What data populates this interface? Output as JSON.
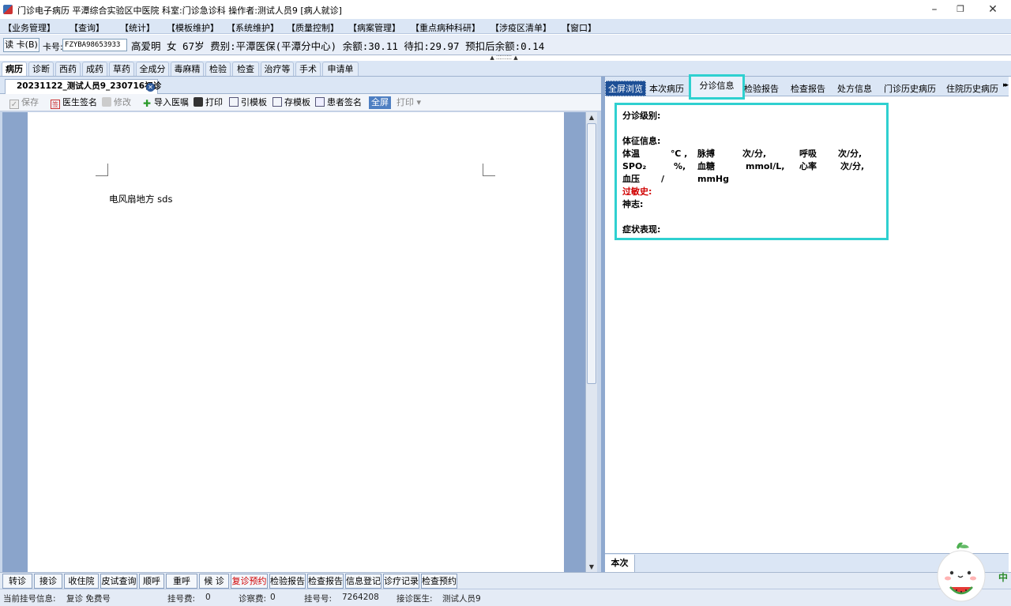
{
  "titlebar": {
    "title": "门诊电子病历  平潭综合实验区中医院  科室:门诊急诊科  操作者:测试人员9  [病人就诊]",
    "minimize": "–",
    "restore": "❐",
    "close": "✕"
  },
  "menu": [
    "【业务管理】",
    "【查询】",
    "【统计】",
    "【模板维护】",
    "【系统维护】",
    "【质量控制】",
    "【病案管理】",
    "【重点病种科研】",
    "【涉疫区清单】",
    "【窗口】"
  ],
  "patient": {
    "read_card": "读 卡(B)",
    "card_label": "卡号:",
    "card_no": "FZYBA98653933",
    "info": "高爱明 女 67岁 费别:平潭医保(平潭分中心) 余额:30.11 待扣:29.97 预扣后余额:0.14"
  },
  "splitter_grip": "▲ ⁚⁚⁚⁚⁚⁚⁚⁚⁚ ▲",
  "main_tabs": [
    "病历",
    "诊断",
    "西药",
    "成药",
    "草药",
    "全成分",
    "毒麻精",
    "检验",
    "检查",
    "治疗等",
    "手术",
    "申请单"
  ],
  "doc": {
    "tab_title": "20231122_测试人员9_230716初诊",
    "tab_close": "✕",
    "content": "电风扇地方 sds"
  },
  "doc_toolbar": {
    "save": "保存",
    "doctor_sign": "医生签名",
    "modify": "修改",
    "import_order": "导入医嘱",
    "print": "打印",
    "cite_template": "引模板",
    "save_template": "存模板",
    "patient_sign": "患者签名",
    "fullscreen": "全屏",
    "print2": "打印",
    "print2_arrow": "▾"
  },
  "scroll": {
    "up": "▲",
    "down": "▼"
  },
  "right_tabs": {
    "full_preview": "全屏浏览",
    "tabs": [
      "本次病历",
      "分诊信息",
      "检验报告",
      "检查报告",
      "处方信息",
      "门诊历史病历",
      "住院历史病历"
    ],
    "more": "▸▸"
  },
  "triage": {
    "level_label": "分诊级别:",
    "vitals_label": "体征信息:",
    "temp": "体温",
    "temp_unit": "℃ ,",
    "pulse": "脉搏",
    "pulse_unit": "次/分,",
    "resp": "呼吸",
    "resp_unit": "次/分,",
    "spo2": "SPO₂",
    "spo2_unit": "%,",
    "glucose": "血糖",
    "glucose_unit": "mmol/L,",
    "heart_rate": "心率",
    "hr_unit": "次/分,",
    "bp": "血压",
    "bp_sep": "/",
    "bp_unit": "mmHg",
    "allergy": "过敏史:",
    "consciousness": "神志:",
    "symptoms": "症状表现:"
  },
  "right_bottom_tab": "本次",
  "bottom_buttons": [
    "转诊",
    "接诊",
    "收住院",
    "皮试查询",
    "顺呼",
    "重呼",
    "候 诊",
    "复诊预约",
    "检验报告",
    "检查报告",
    "信息登记",
    "诊疗记录",
    "检查预约"
  ],
  "status": {
    "current": "当前挂号信息:",
    "type": "复诊 免费号",
    "reg_fee_label": "挂号费:",
    "reg_fee": "0",
    "diag_fee_label": "诊察费:",
    "diag_fee": "0",
    "reg_no_label": "挂号号:",
    "reg_no": "7264208",
    "doctor_label": "接诊医生:",
    "doctor": "测试人员9"
  },
  "ime": "中",
  "colors": {
    "highlight": "#2fd0d0",
    "accent": "#1d4f96",
    "menu_bg": "#dbe6f5",
    "alert": "#d00000"
  }
}
